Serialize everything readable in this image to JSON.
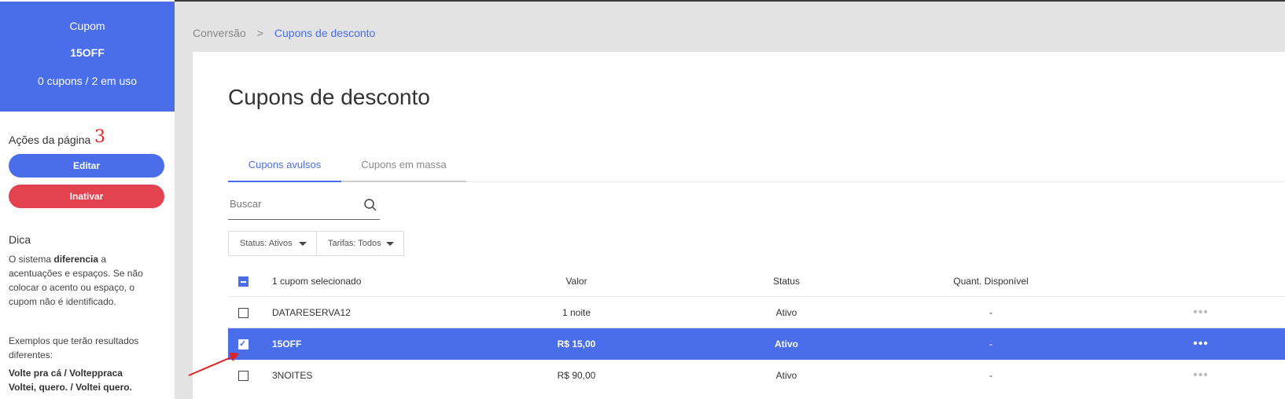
{
  "sidebar": {
    "coupon_label": "Cupom",
    "coupon_code": "15OFF",
    "coupon_count": "0 cupons / 2 em uso",
    "actions_title": "Ações da página",
    "annotation_number": "3",
    "edit_label": "Editar",
    "inactivate_label": "Inativar",
    "tip_title": "Dica",
    "tip_text_pre": "O sistema ",
    "tip_text_bold": "diferencia",
    "tip_text_post": " a acentuações e espaços. Se não colocar o acento ou espaço, o cupom não é identificado.",
    "tip_examples": "Exemplos que terão resultados diferentes:",
    "tip_example_1": "Volte pra cá / Volteppraca",
    "tip_example_2": "Voltei, quero. / Voltei quero."
  },
  "breadcrumb": {
    "parent": "Conversão",
    "separator": ">",
    "current": "Cupons de desconto"
  },
  "main": {
    "title": "Cupons de desconto",
    "tabs": [
      {
        "label": "Cupons avulsos",
        "active": true
      },
      {
        "label": "Cupons em massa",
        "active": false
      }
    ],
    "search_placeholder": "Buscar",
    "filters": [
      {
        "label": "Status: Ativos"
      },
      {
        "label": "Tarifas: Todos"
      }
    ]
  },
  "table": {
    "headers": {
      "selection": "1 cupom selecionado",
      "valor": "Valor",
      "status": "Status",
      "qtd": "Quant. Disponível"
    },
    "rows": [
      {
        "name": "DATARESERVA12",
        "valor": "1 noite",
        "status": "Ativo",
        "qtd": "-",
        "selected": false,
        "more": "•••"
      },
      {
        "name": "15OFF",
        "valor": "R$ 15,00",
        "status": "Ativo",
        "qtd": "-",
        "selected": true,
        "more": "•••"
      },
      {
        "name": "3NOITES",
        "valor": "R$ 90,00",
        "status": "Ativo",
        "qtd": "-",
        "selected": false,
        "more": "•••"
      }
    ]
  },
  "colors": {
    "accent": "#4a6ee9",
    "danger": "#e3434f",
    "annotation": "#e22222"
  }
}
